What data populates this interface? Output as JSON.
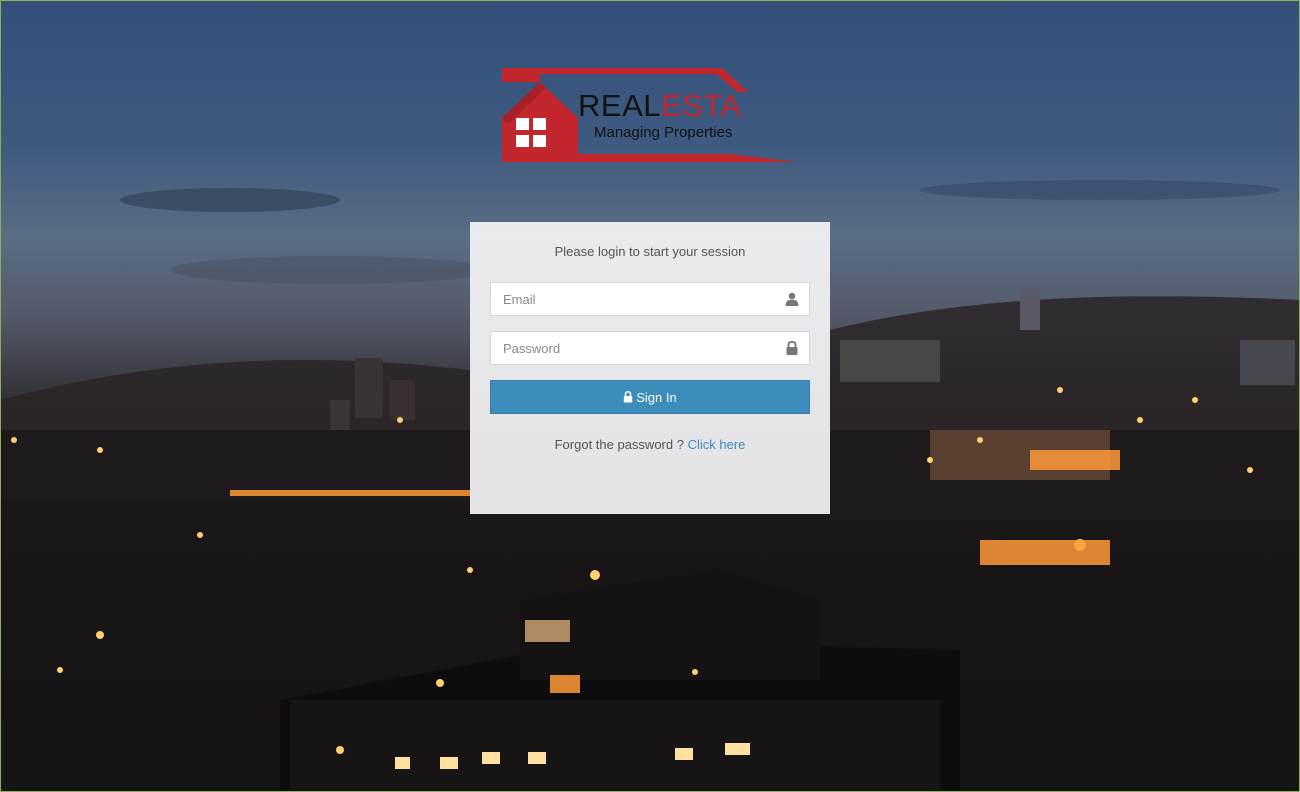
{
  "brand": {
    "name_part1": "REAL",
    "name_part2": "ESTA",
    "tagline": "Managing Properties",
    "accent_color": "#c1272d"
  },
  "login": {
    "message": "Please login to start your session",
    "email_placeholder": "Email",
    "email_value": "",
    "email_icon": "user-icon",
    "password_placeholder": "Password",
    "password_value": "",
    "password_icon": "lock-icon",
    "signin_label": "Sign In",
    "signin_color": "#3c8dbc",
    "forgot_text": "Forgot the password ? ",
    "forgot_link": "Click here"
  }
}
